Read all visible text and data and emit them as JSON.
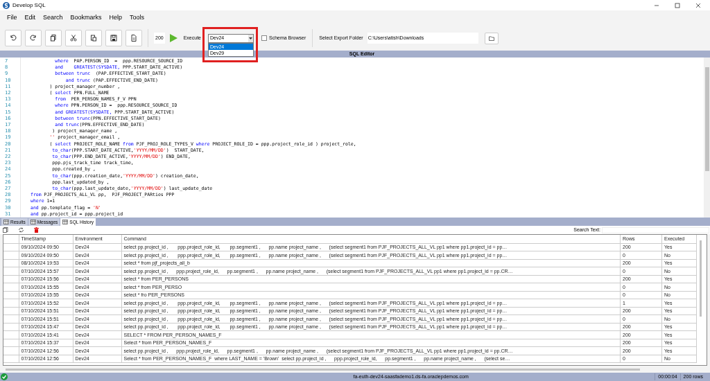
{
  "window": {
    "title": "Develop SQL"
  },
  "menu": [
    {
      "label": "File"
    },
    {
      "label": "Edit"
    },
    {
      "label": "Search"
    },
    {
      "label": "Bookmarks"
    },
    {
      "label": "Help"
    },
    {
      "label": "Tools"
    }
  ],
  "toolbar": {
    "row_limit": "200",
    "execute_label": "Execute",
    "environment": {
      "value": "Dev24",
      "expanded": true,
      "options": [
        {
          "label": "Dev24",
          "selected": true
        },
        {
          "label": "Dev29",
          "selected": false
        }
      ]
    },
    "schema_browser": {
      "label": "Schema Browser",
      "checked": false
    },
    "export_folder": {
      "label": "Select Export Folder",
      "value": "C:\\Users\\atish\\Downloads"
    }
  },
  "editor": {
    "title": "SQL Editor",
    "lines": [
      {
        "number": "7",
        "tokens": [
          {
            "kind": "keyword",
            "text": "         where"
          },
          {
            "kind": "plain",
            "text": "  PAP.PERSON_ID  =  ppp.RESOURCE_SOURCE_ID"
          }
        ]
      },
      {
        "number": "8",
        "tokens": [
          {
            "kind": "keyword",
            "text": "         and"
          },
          {
            "kind": "keyword",
            "text": "    GREATEST(SYSDATE,"
          },
          {
            "kind": "plain",
            "text": " PPP.START_DATE_ACTIVE)"
          }
        ]
      },
      {
        "number": "9",
        "tokens": [
          {
            "kind": "keyword",
            "text": "         between trunc"
          },
          {
            "kind": "plain",
            "text": "  (PAP.EFFECTIVE_START_DATE)"
          }
        ]
      },
      {
        "number": "10",
        "tokens": [
          {
            "kind": "keyword",
            "text": "             and trunc"
          },
          {
            "kind": "plain",
            "text": " (PAP.EFFECTIVE_END_DATE)"
          }
        ]
      },
      {
        "number": "11",
        "tokens": [
          {
            "kind": "plain",
            "text": "       ) project_manager_number ,"
          }
        ]
      },
      {
        "number": "12",
        "tokens": [
          {
            "kind": "plain",
            "text": "       ( "
          },
          {
            "kind": "keyword",
            "text": "select"
          },
          {
            "kind": "plain",
            "text": " PPN.FULL_NAME"
          }
        ]
      },
      {
        "number": "13",
        "tokens": [
          {
            "kind": "keyword",
            "text": "         from"
          },
          {
            "kind": "plain",
            "text": "  PER_PERSON_NAMES_F_V PPN"
          }
        ]
      },
      {
        "number": "14",
        "tokens": [
          {
            "kind": "keyword",
            "text": "         where"
          },
          {
            "kind": "plain",
            "text": " PPN.PERSON_ID =  ppp.RESOURCE_SOURCE_ID"
          }
        ]
      },
      {
        "number": "15",
        "tokens": [
          {
            "kind": "keyword",
            "text": "         and GREATEST(SYSDATE,"
          },
          {
            "kind": "plain",
            "text": " PPP.START_DATE_ACTIVE)"
          }
        ]
      },
      {
        "number": "16",
        "tokens": [
          {
            "kind": "keyword",
            "text": "         between trunc"
          },
          {
            "kind": "plain",
            "text": "(PPN.EFFECTIVE_START_DATE)"
          }
        ]
      },
      {
        "number": "17",
        "tokens": [
          {
            "kind": "keyword",
            "text": "         and trunc"
          },
          {
            "kind": "plain",
            "text": "(PPN.EFFECTIVE_END_DATE)"
          }
        ]
      },
      {
        "number": "18",
        "tokens": [
          {
            "kind": "plain",
            "text": "        ) project_manager_name ,"
          }
        ]
      },
      {
        "number": "19",
        "tokens": [
          {
            "kind": "string",
            "text": "       ''"
          },
          {
            "kind": "plain",
            "text": " project_manager_email ,"
          }
        ]
      },
      {
        "number": "20",
        "tokens": [
          {
            "kind": "plain",
            "text": "       ( "
          },
          {
            "kind": "keyword",
            "text": "select"
          },
          {
            "kind": "plain",
            "text": " PROJECT_ROLE_NAME "
          },
          {
            "kind": "keyword",
            "text": "from"
          },
          {
            "kind": "plain",
            "text": " PJF_PROJ_ROLE_TYPES_V "
          },
          {
            "kind": "keyword",
            "text": "where"
          },
          {
            "kind": "plain",
            "text": " PROJECT_ROLE_ID = ppp.project_role_id ) project_role,"
          }
        ]
      },
      {
        "number": "21",
        "tokens": [
          {
            "kind": "keyword",
            "text": "        to_char"
          },
          {
            "kind": "plain",
            "text": "(PPP.START_DATE_ACTIVE,"
          },
          {
            "kind": "string",
            "text": "'YYYY/MM/DD'"
          },
          {
            "kind": "plain",
            "text": ")  START_DATE,"
          }
        ]
      },
      {
        "number": "22",
        "tokens": [
          {
            "kind": "keyword",
            "text": "        to_char"
          },
          {
            "kind": "plain",
            "text": "(PPP.END_DATE_ACTIVE,"
          },
          {
            "kind": "string",
            "text": "'YYYY/MM/DD'"
          },
          {
            "kind": "plain",
            "text": ") END_DATE,"
          }
        ]
      },
      {
        "number": "23",
        "tokens": [
          {
            "kind": "plain",
            "text": "        ppp.pjs_track_time track_time,"
          }
        ]
      },
      {
        "number": "24",
        "tokens": [
          {
            "kind": "plain",
            "text": "        ppp.created_by ,"
          }
        ]
      },
      {
        "number": "25",
        "tokens": [
          {
            "kind": "keyword",
            "text": "        to_char"
          },
          {
            "kind": "plain",
            "text": "(ppp.creation_date,"
          },
          {
            "kind": "string",
            "text": "'YYYY/MM/DD'"
          },
          {
            "kind": "plain",
            "text": ") creation_date,"
          }
        ]
      },
      {
        "number": "26",
        "tokens": [
          {
            "kind": "plain",
            "text": "        ppp.last_updated_by ,"
          }
        ]
      },
      {
        "number": "27",
        "tokens": [
          {
            "kind": "keyword",
            "text": "        to_char"
          },
          {
            "kind": "plain",
            "text": "(ppp.last_update_date,"
          },
          {
            "kind": "string",
            "text": "'YYYY/MM/DD'"
          },
          {
            "kind": "plain",
            "text": ") last_update_date"
          }
        ]
      },
      {
        "number": "28",
        "tokens": [
          {
            "kind": "keyword",
            "text": "from"
          },
          {
            "kind": "plain",
            "text": " PJF_PROJECTS_ALL_VL pp,  PJF_PROJECT_PARties PPP"
          }
        ]
      },
      {
        "number": "29",
        "tokens": [
          {
            "kind": "keyword",
            "text": "where"
          },
          {
            "kind": "plain",
            "text": " 1=1"
          }
        ]
      },
      {
        "number": "30",
        "tokens": [
          {
            "kind": "keyword",
            "text": "and"
          },
          {
            "kind": "plain",
            "text": " pp.template_flag = "
          },
          {
            "kind": "string",
            "text": "'N'"
          }
        ]
      },
      {
        "number": "31",
        "tokens": [
          {
            "kind": "keyword",
            "text": "and"
          },
          {
            "kind": "plain",
            "text": " pp.project_id = ppp.project_id"
          }
        ]
      }
    ]
  },
  "result_tabs": [
    {
      "label": "Results",
      "selected": false
    },
    {
      "label": "Messages",
      "selected": false
    },
    {
      "label": "SQL History",
      "selected": true
    }
  ],
  "history": {
    "search_label": "Search Text:",
    "columns": [
      "TimeStamp",
      "Environment",
      "Command",
      "Rows",
      "Executed"
    ],
    "rows": [
      [
        "09/10/2024 09:50",
        "Dev24",
        "select pp.project_id ,       ppp.project_role_id,       pp.segment1 ,      pp.name project_name ,      (select segment1 from PJF_PROJECTS_ALL_VL pp1 where pp1.project_id = pp…",
        "200",
        "Yes"
      ],
      [
        "09/10/2024 09:50",
        "Dev24",
        "select pp.project_id ,       ppp.project_role_id,       pp.segment1 ,      pp.name project_name ,      (select segment1 from PJF_PROJECTS_ALL_VL pp1 where pp1.project_id = pp…",
        "0",
        "No"
      ],
      [
        "08/10/2024 19:53",
        "Dev24",
        "select * from pjf_projects_all_b",
        "200",
        "Yes"
      ],
      [
        "07/10/2024 15:57",
        "Dev24",
        "select pp.project_id ,      ppp.project_role_id,      pp.segment1 ,      pp.name project_name ,      (select segment1 from PJF_PROJECTS_ALL_VL pp1 where pp1.project_id = pp.CR…",
        "0",
        "No"
      ],
      [
        "07/10/2024 15:56",
        "Dev24",
        "select * from PER_PERSONS",
        "200",
        "Yes"
      ],
      [
        "07/10/2024 15:55",
        "Dev24",
        "select * from PER_PERSO",
        "0",
        "No"
      ],
      [
        "07/10/2024 15:55",
        "Dev24",
        "select * fro PER_PERSONS",
        "0",
        "No"
      ],
      [
        "07/10/2024 15:52",
        "Dev24",
        "select pp.project_id ,       ppp.project_role_id,       pp.segment1 ,      pp.name project_name ,      (select segment1 from PJF_PROJECTS_ALL_VL pp1 where pp1.project_id = pp…",
        "1",
        "Yes"
      ],
      [
        "07/10/2024 15:51",
        "Dev24",
        "select pp.project_id ,       ppp.project_role_id,       pp.segment1 ,      pp.name project_name ,      (select segment1 from PJF_PROJECTS_ALL_VL pp1 where pp1.project_id = pp…",
        "200",
        "Yes"
      ],
      [
        "07/10/2024 15:51",
        "Dev24",
        "select pp.project_id ,       ppp.project_role_id,       pp.segment1 ,      pp.name project_name ,      (select segment1 from PJF_PROJECTS_ALL_VL pp1 where pp1.project_id = pp…",
        "0",
        "No"
      ],
      [
        "07/10/2024 15:47",
        "Dev24",
        "select pp.project_id ,       ppp.project_role_id,       pp.segment1 ,      pp.name project_name ,      (select segment1 from PJF_PROJECTS_ALL_VL pp1 where pp1.project_id = pp…",
        "200",
        "Yes"
      ],
      [
        "07/10/2024 15:41",
        "Dev24",
        "SELECT * FROM PER_PERSON_NAMES_F",
        "200",
        "Yes"
      ],
      [
        "07/10/2024 15:37",
        "Dev24",
        "Select * from PER_PERSON_NAMES_F",
        "200",
        "Yes"
      ],
      [
        "07/10/2024 12:56",
        "Dev24",
        "select pp.project_id ,      ppp.project_role_id,      pp.segment1 ,      pp.name project_name ,      (select segment1 from PJF_PROJECTS_ALL_VL pp1 where pp1.project_id = pp.CR…",
        "200",
        "Yes"
      ],
      [
        "07/10/2024 12:56",
        "Dev24",
        "Select * from PER_PERSON_NAMES_F  where LAST_NAME = 'Brown'  select pp.project_id ,      ppp.project_role_id,      pp.segment1 ,      pp.name project_name ,      (select se…",
        "0",
        "No"
      ]
    ]
  },
  "status_bar": {
    "host": "fa-euth-dev24-saasfademo1.ds-fa.oraclepdemos.com",
    "elapsed": "00:00:04",
    "rows": "200 rows"
  }
}
